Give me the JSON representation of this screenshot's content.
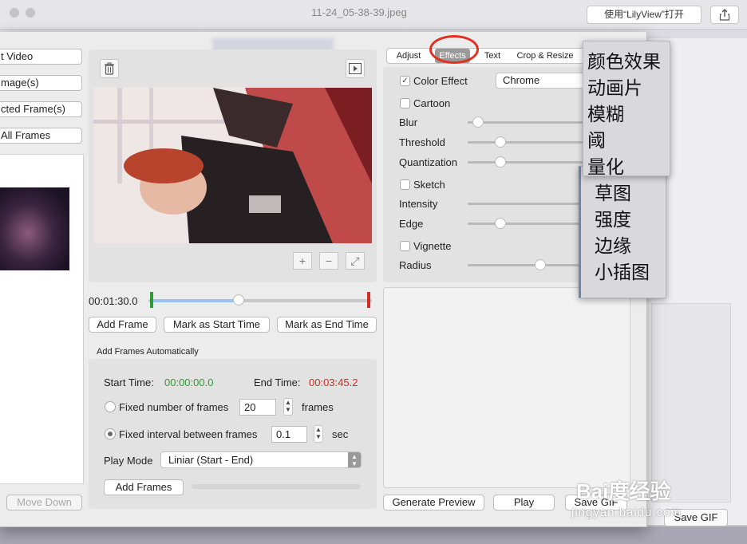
{
  "background_window": {
    "filename": "11-24_05-38-39.jpeg",
    "open_with_label": "使用“LilyView”打开",
    "save_gif_label": "Save GIF"
  },
  "left_column": {
    "buttons": [
      "t Video",
      "mage(s)",
      "cted Frame(s)",
      "All Frames"
    ],
    "move_down_label": "Move Down"
  },
  "preview": {
    "time": "00:01:30.0",
    "add_frame_label": "Add Frame",
    "mark_start_label": "Mark as Start Time",
    "mark_end_label": "Mark as End Time",
    "plus_symbol": "+",
    "minus_symbol": "−",
    "expand_symbol": "⤢"
  },
  "auto_frames": {
    "title": "Add Frames Automatically",
    "start_label": "Start Time:",
    "start_value": "00:00:00.0",
    "end_label": "End Time:",
    "end_value": "00:03:45.2",
    "fixed_number_label": "Fixed number of frames",
    "fixed_number_value": "20",
    "frames_unit": "frames",
    "fixed_interval_label": "Fixed interval between frames",
    "fixed_interval_value": "0.1",
    "sec_unit": "sec",
    "play_mode_label": "Play Mode",
    "play_mode_value": "Liniar (Start - End)",
    "add_frames_label": "Add Frames",
    "selected_mode": "fixed_interval"
  },
  "tabs": [
    {
      "label": "Adjust"
    },
    {
      "label": "Effects",
      "active": true
    },
    {
      "label": "Text"
    },
    {
      "label": "Crop & Resize"
    }
  ],
  "effects": {
    "color_effect_label": "Color Effect",
    "color_effect_checked": true,
    "color_effect_value": "Chrome",
    "cartoon_label": "Cartoon",
    "blur_label": "Blur",
    "blur_level": 0.08,
    "threshold_label": "Threshold",
    "threshold_level": 0.28,
    "quantization_label": "Quantization",
    "quantization_level": 0.28,
    "sketch_label": "Sketch",
    "intensity_label": "Intensity",
    "edge_label": "Edge",
    "edge_level": 0.28,
    "vignette_label": "Vignette",
    "radius_label": "Radius",
    "radius_level": 0.65
  },
  "bottom_buttons": {
    "generate_preview": "Generate Preview",
    "play": "Play",
    "save_gif": "Save GIF"
  },
  "annotation_menu_1": [
    "颜色效果",
    "动画片",
    "模糊",
    "阈",
    "量化"
  ],
  "annotation_menu_2": [
    "草图",
    "强度",
    "边缘",
    "小插图"
  ],
  "watermark": {
    "brand": "Bai度经验",
    "url": "jingyan.baidu.com"
  },
  "colors": {
    "start_time_color": "#2e9b35",
    "end_time_color": "#d12b25",
    "highlight_color": "#e1301f"
  }
}
